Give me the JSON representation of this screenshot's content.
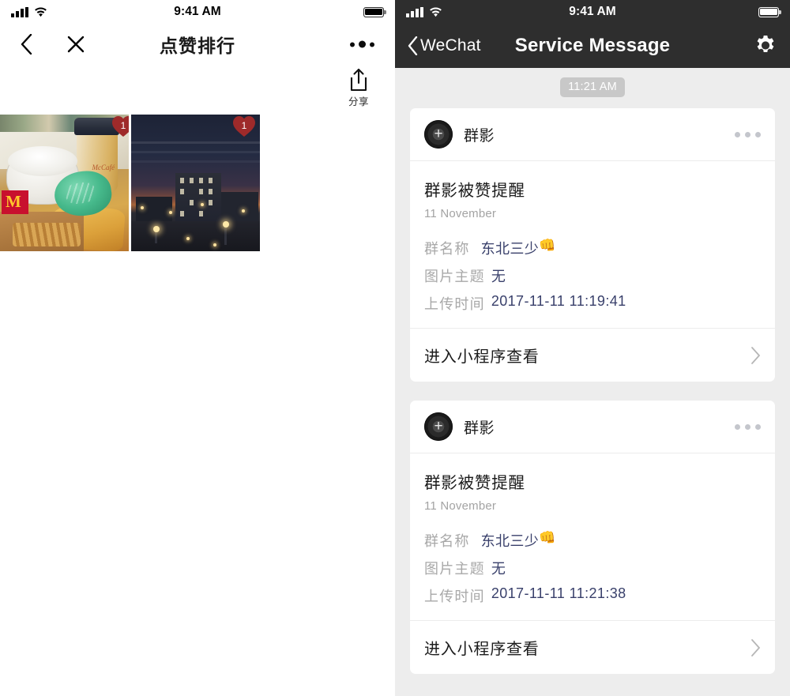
{
  "left_panel": {
    "status_bar": {
      "time": "9:41 AM",
      "signal_icon": "signal-bars-icon",
      "wifi_icon": "wifi-icon",
      "battery_icon": "battery-icon"
    },
    "nav": {
      "back_icon": "chevron-left-icon",
      "close_icon": "close-x-icon",
      "title": "点赞排行",
      "more_icon": "more-dots-icon"
    },
    "share": {
      "icon": "share-upload-icon",
      "label": "分享"
    },
    "photos": [
      {
        "name": "mcdonalds-meal-photo",
        "alt": "McDonald's meal with McCafé cup, wrapped sandwich and fries box on a tray",
        "like_count": "1",
        "badge_icon": "heart-badge-icon"
      },
      {
        "name": "city-dusk-photo",
        "alt": "Dusk cityscape with apartment building and street lights",
        "like_count": "1",
        "badge_icon": "heart-badge-icon"
      }
    ]
  },
  "right_panel": {
    "status_bar": {
      "time": "9:41 AM",
      "signal_icon": "signal-bars-icon",
      "wifi_icon": "wifi-icon",
      "battery_icon": "battery-icon"
    },
    "nav": {
      "back_icon": "chevron-left-icon",
      "back_label": "WeChat",
      "title": "Service Message",
      "settings_icon": "gear-icon"
    },
    "timestamp_pill": "11:21 AM",
    "messages": [
      {
        "avatar_icon": "group-shadow-avatar-icon",
        "account_name": "群影",
        "menu_icon": "more-dots-icon",
        "title": "群影被赞提醒",
        "date": "11 November",
        "details": [
          {
            "label": "群名称",
            "value": "东北三少",
            "emoji": "👊"
          },
          {
            "label": "图片主题",
            "value": "无",
            "emoji": ""
          },
          {
            "label": "上传时间",
            "value": "2017-11-11 11:19:41",
            "emoji": ""
          }
        ],
        "footer_label": "进入小程序查看",
        "footer_icon": "chevron-right-icon"
      },
      {
        "avatar_icon": "group-shadow-avatar-icon",
        "account_name": "群影",
        "menu_icon": "more-dots-icon",
        "title": "群影被赞提醒",
        "date": "11 November",
        "details": [
          {
            "label": "群名称",
            "value": "东北三少",
            "emoji": "👊"
          },
          {
            "label": "图片主题",
            "value": "无",
            "emoji": ""
          },
          {
            "label": "上传时间",
            "value": "2017-11-11 11:21:38",
            "emoji": ""
          }
        ],
        "footer_label": "进入小程序查看",
        "footer_icon": "chevron-right-icon"
      }
    ]
  },
  "colors": {
    "nav_dark": "#2e2e2e",
    "chat_background": "#ededed",
    "card_white": "#ffffff",
    "value_blue": "#39406b",
    "label_gray": "#a8a8a8",
    "pill_gray": "#c8c8c8",
    "heart_red": "#9e2a2a"
  }
}
